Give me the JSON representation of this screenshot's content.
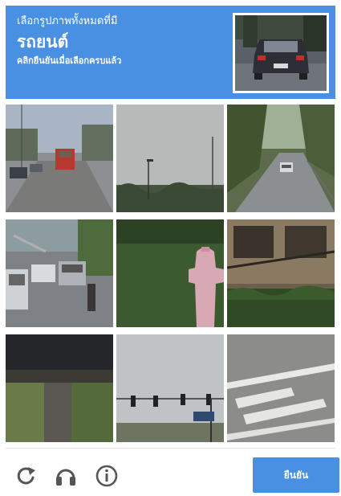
{
  "header": {
    "instruction": "เลือกรูปภาพทั้งหมดที่มี",
    "target": "รถยนต์",
    "hint": "คลิกยืนยันเมื่อเลือกครบแล้ว"
  },
  "tiles": [
    {
      "name": "tile-street-truck",
      "scene": "street with red truck"
    },
    {
      "name": "tile-sky-treeline",
      "scene": "overcast sky above trees"
    },
    {
      "name": "tile-road-car",
      "scene": "tree-lined road with car"
    },
    {
      "name": "tile-parked-cars",
      "scene": "parked cars and pedestrian"
    },
    {
      "name": "tile-hydrant",
      "scene": "grass with hydrant"
    },
    {
      "name": "tile-building",
      "scene": "building wall and hedge"
    },
    {
      "name": "tile-bridge",
      "scene": "bridge underpass"
    },
    {
      "name": "tile-traffic-lights",
      "scene": "traffic lights"
    },
    {
      "name": "tile-road-marking",
      "scene": "road marking"
    }
  ],
  "footer": {
    "verify_label": "ยืนยัน",
    "icons": [
      "reload-icon",
      "audio-challenge-icon",
      "info-icon"
    ]
  },
  "colors": {
    "accent": "#4a90e2",
    "icon": "#555555",
    "divider": "#dfe1e5"
  }
}
